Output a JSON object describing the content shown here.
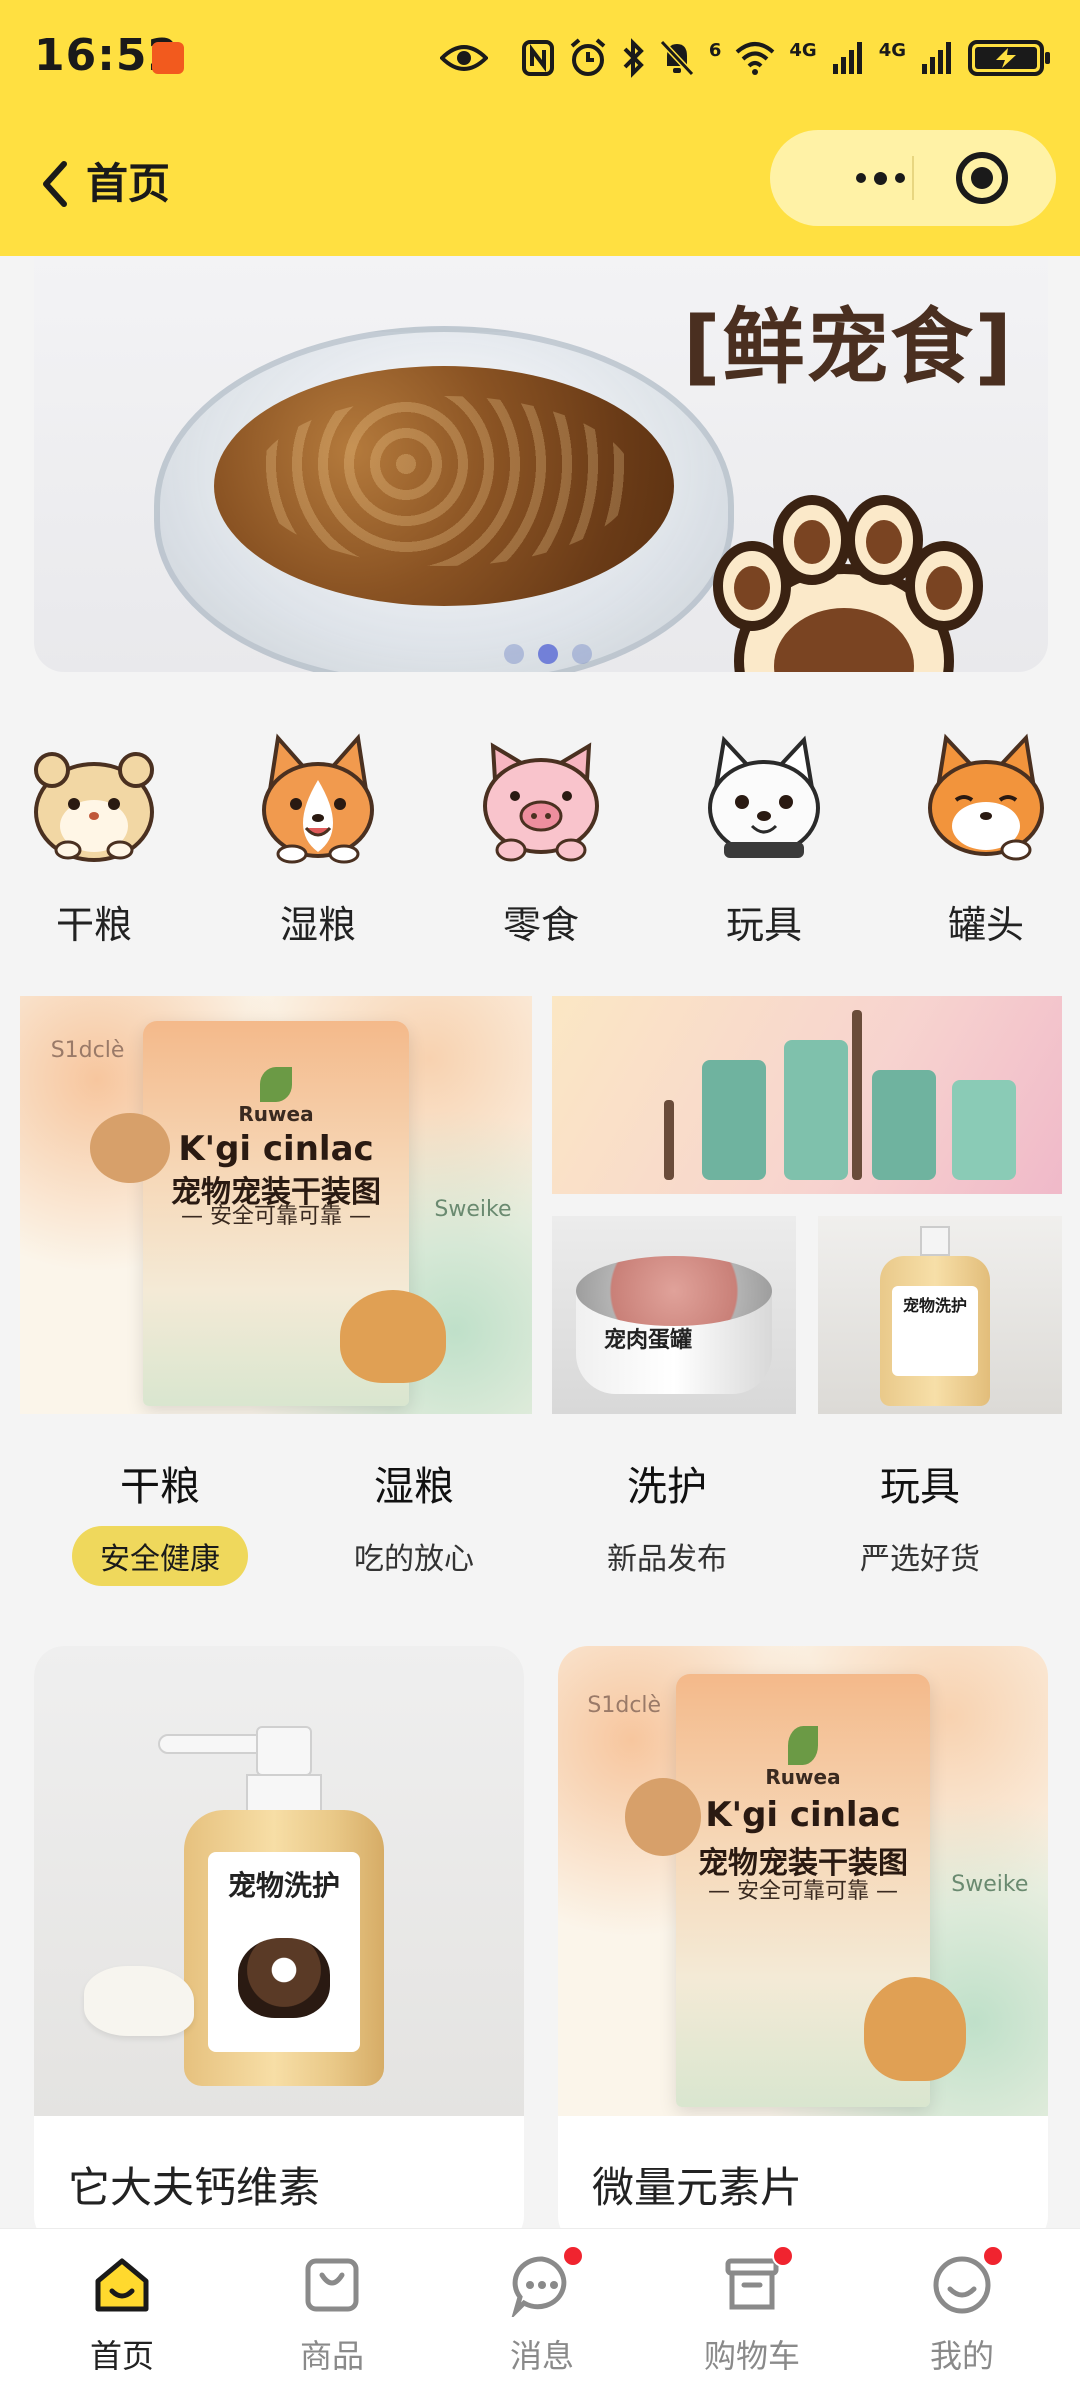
{
  "status_bar": {
    "time": "16:52",
    "network_1": "4G",
    "network_2": "4G"
  },
  "nav": {
    "title": "首页"
  },
  "banner": {
    "text": "[鲜宠食]",
    "active_slide": 1,
    "slide_count": 3
  },
  "categories": [
    {
      "label": "干粮",
      "icon": "hamster-icon"
    },
    {
      "label": "湿粮",
      "icon": "corgi-icon"
    },
    {
      "label": "零食",
      "icon": "pig-icon"
    },
    {
      "label": "玩具",
      "icon": "white-dog-icon"
    },
    {
      "label": "罐头",
      "icon": "shiba-icon"
    }
  ],
  "promo": {
    "big": {
      "side_text": "S1dclè",
      "brand": "Ruwea",
      "title": "K'gi cinlac",
      "cn_title": "宠物宠装干装图",
      "cn_sub": "— 安全可靠可靠 —",
      "right_text": "Sweike"
    },
    "can": {
      "label": "宠肉蛋罐"
    },
    "bottle": {
      "label": "宠物洗护"
    }
  },
  "tabs": [
    {
      "title": "干粮",
      "sub": "安全健康",
      "active": true
    },
    {
      "title": "湿粮",
      "sub": "吃的放心",
      "active": false
    },
    {
      "title": "洗护",
      "sub": "新品发布",
      "active": false
    },
    {
      "title": "玩具",
      "sub": "严选好货",
      "active": false
    }
  ],
  "products": [
    {
      "name": "它大夫钙维素",
      "image_label": "宠物洗护"
    },
    {
      "name": "微量元素片",
      "image_brand": "Ruwea",
      "image_title": "K'gi cinlac",
      "image_cn": "宠物宠装干装图",
      "image_cn_sub": "— 安全可靠可靠 —",
      "image_side": "S1dclè",
      "image_right": "Sweike"
    }
  ],
  "bottom_nav": [
    {
      "label": "首页",
      "icon": "home-icon",
      "active": true,
      "badge": false
    },
    {
      "label": "商品",
      "icon": "bag-icon",
      "active": false,
      "badge": false
    },
    {
      "label": "消息",
      "icon": "message-icon",
      "active": false,
      "badge": true
    },
    {
      "label": "购物车",
      "icon": "cart-box-icon",
      "active": false,
      "badge": true
    },
    {
      "label": "我的",
      "icon": "smile-icon",
      "active": false,
      "badge": true
    }
  ],
  "colors": {
    "accent": "#ffe041",
    "tab_active": "#efd85c",
    "badge": "#f0242f"
  }
}
